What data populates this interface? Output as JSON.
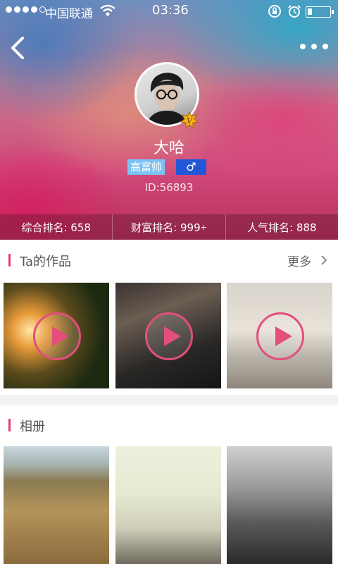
{
  "status": {
    "carrier": "中国联通",
    "time": "03:36"
  },
  "profile": {
    "name": "大哈",
    "tag": "高富帅",
    "gender_symbol": "♂",
    "id_text": "ID:56893",
    "badge_letter": "V"
  },
  "ranks": {
    "overall": "综合排名: 658",
    "wealth": "财富排名: 999",
    "wealth_sup": "+",
    "popularity": "人气排名: 888"
  },
  "works": {
    "title": "Ta的作品",
    "more": "更多"
  },
  "album": {
    "title": "相册"
  },
  "icons": [
    "back-icon",
    "more-icon",
    "play-icon",
    "chevron-right-icon"
  ],
  "colors": {
    "accent": "#e83a78",
    "tag_bg": "#7cc2f3",
    "gender_bg": "#2258d8"
  }
}
